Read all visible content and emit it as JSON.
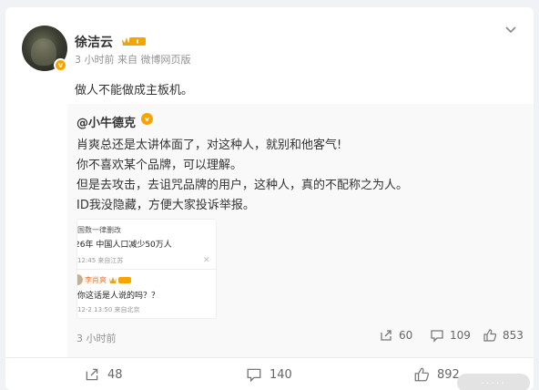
{
  "post": {
    "username": "徐洁云",
    "meta": "3 小时前  来自 微博网页版",
    "text": "做人不能做成主板机。"
  },
  "repost": {
    "username": "@小牛德克",
    "lines": [
      "肖爽总还是太讲体面了，对这种人，就别和他客气!",
      "你不喜欢某个品牌，可以理解。",
      "但是去攻击，去诅咒品牌的用户，这种人，真的不配称之为人。",
      "ID我没隐藏，方便大家投诉举报。"
    ],
    "image": {
      "line1": "国数一律删改",
      "line2": "26年 中国人口减少50万人",
      "line3": "12:45 来自江苏",
      "close": "✕",
      "reply_name": "李肖爽",
      "reply_text": "你这话是人说的吗？？",
      "reply_meta": "12-2 13:50 来自北京"
    },
    "time": "3 小时前",
    "actions": {
      "share": "60",
      "comment": "109",
      "like": "853"
    }
  },
  "actions": {
    "share": "48",
    "comment": "140",
    "like": "892"
  },
  "colors": {
    "accent": "#f7a400",
    "muted": "#939393",
    "background": "#f1f2f5"
  }
}
